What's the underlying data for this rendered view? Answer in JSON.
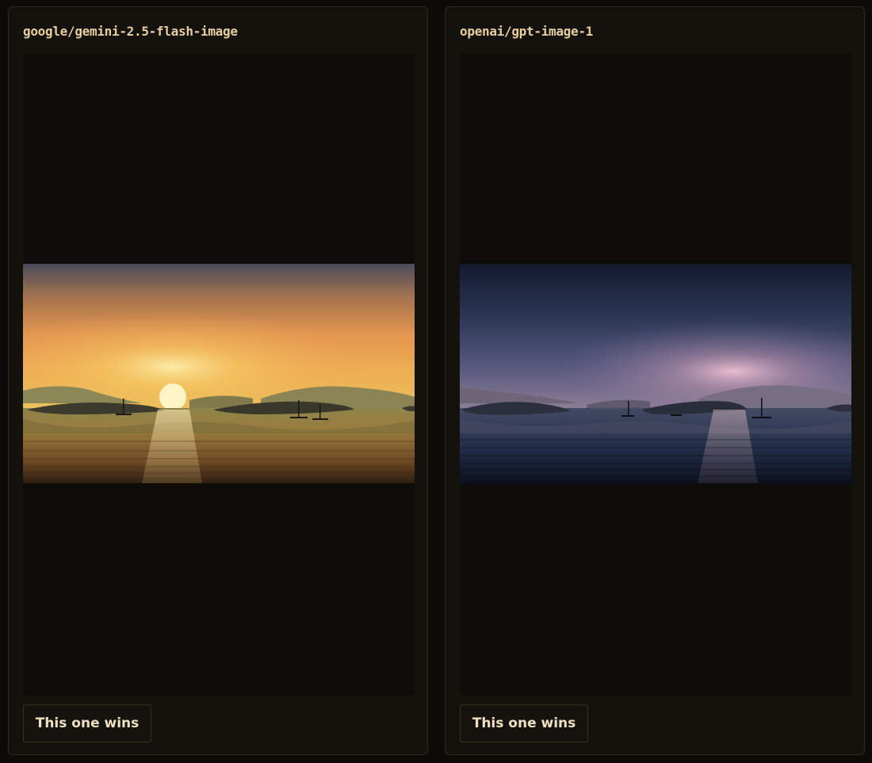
{
  "panels": [
    {
      "model": "google/gemini-2.5-flash-image",
      "button_label": "This one wins",
      "image_theme": "golden sunset over calm lake with islands and sailboats"
    },
    {
      "model": "openai/gpt-image-1",
      "button_label": "This one wins",
      "image_theme": "dusk with blue-violet sky over calm lake with islands and sailboats"
    }
  ],
  "colors": {
    "background": "#0c0b08",
    "panel": "#13120d",
    "panel_border": "#2e2b1e",
    "model_text": "#e7cf9d",
    "button_text": "#efe1c0"
  }
}
